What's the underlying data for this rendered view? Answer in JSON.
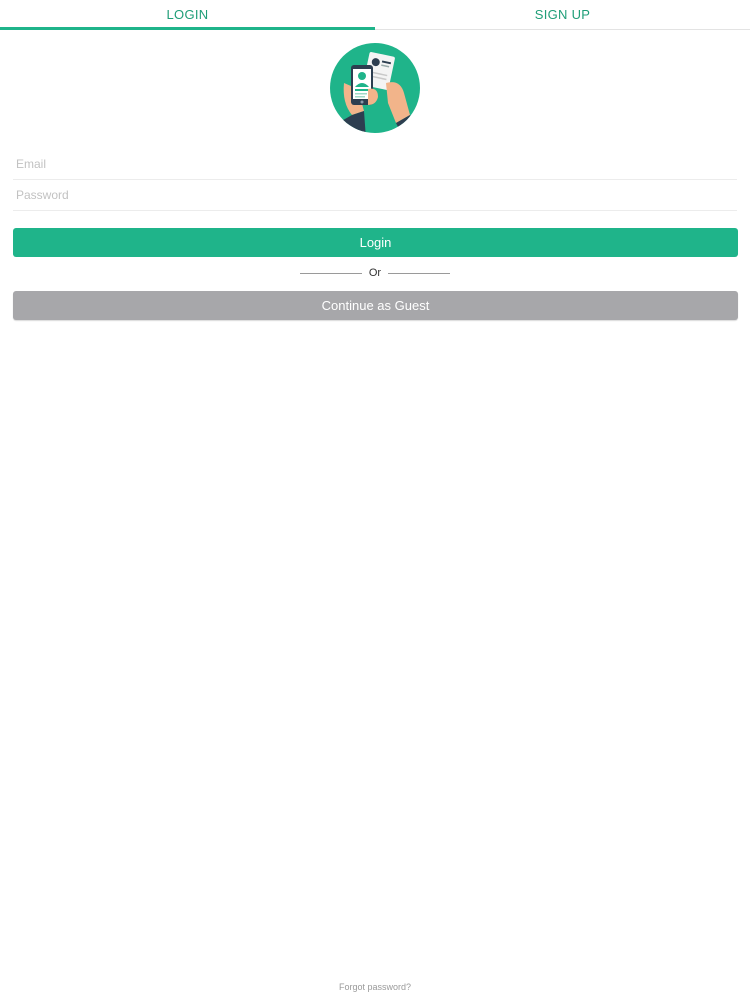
{
  "tabs": {
    "login_label": "LOGIN",
    "signup_label": "SIGN UP",
    "active": "login"
  },
  "form": {
    "email_placeholder": "Email",
    "email_value": "",
    "password_placeholder": "Password",
    "password_value": ""
  },
  "buttons": {
    "login_label": "Login",
    "divider_text": "Or",
    "guest_label": "Continue as Guest"
  },
  "footer": {
    "forgot_label": "Forgot password?"
  },
  "logo": {
    "icon": "phone-id-card-icon"
  },
  "colors": {
    "accent": "#1fb48a",
    "tab_text": "#1f9e78",
    "guest_button": "#a7a7aa"
  }
}
